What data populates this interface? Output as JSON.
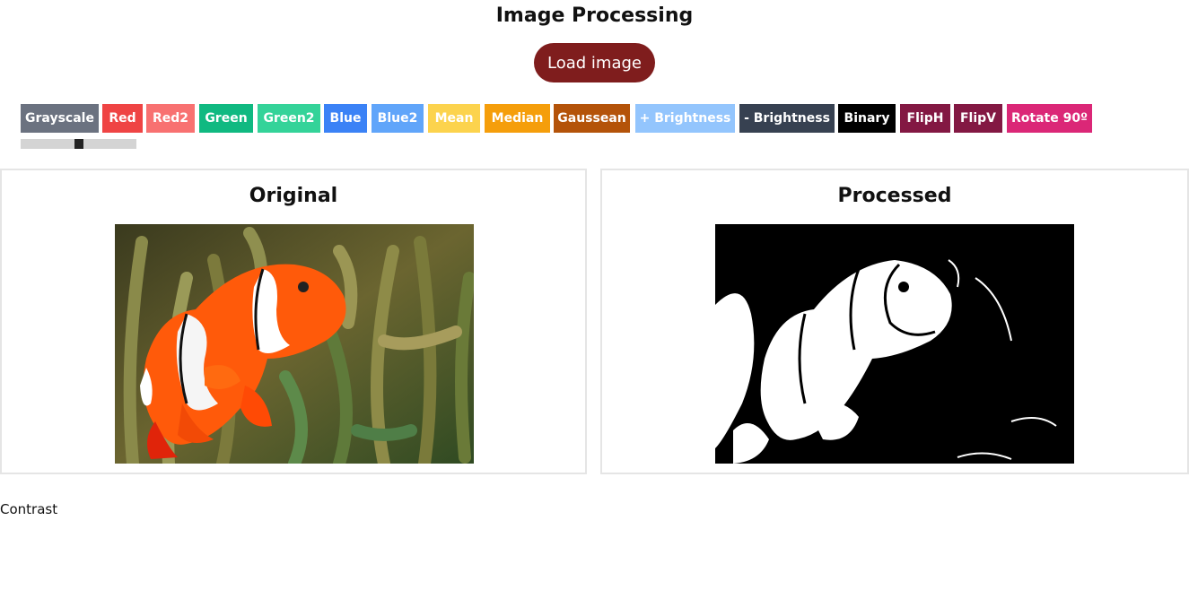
{
  "header": {
    "title": "Image Processing"
  },
  "load_button": {
    "label": "Load image"
  },
  "toolbar": {
    "buttons": [
      {
        "label": "Grayscale",
        "color": "#6b7280"
      },
      {
        "label": "Red",
        "color": "#ef4444"
      },
      {
        "label": "Red2",
        "color": "#f87171"
      },
      {
        "label": "Green",
        "color": "#10b981"
      },
      {
        "label": "Green2",
        "color": "#34d399"
      },
      {
        "label": "Blue",
        "color": "#3b82f6"
      },
      {
        "label": "Blue2",
        "color": "#60a5fa"
      },
      {
        "label": "Mean",
        "color": "#fcd34d"
      },
      {
        "label": "Median",
        "color": "#f59e0b"
      },
      {
        "label": "Gaussean",
        "color": "#b45309"
      },
      {
        "label": "+ Brightness",
        "color": "#93c5fd"
      },
      {
        "label": "- Brightness",
        "color": "#374151"
      },
      {
        "label": "Binary",
        "color": "#000000"
      },
      {
        "label": "FlipH",
        "color": "#831843"
      },
      {
        "label": "FlipV",
        "color": "#831843"
      },
      {
        "label": "Rotate 90º",
        "color": "#db2777"
      }
    ]
  },
  "slider": {
    "value": 0.5
  },
  "panels": {
    "original": {
      "title": "Original"
    },
    "processed": {
      "title": "Processed"
    }
  },
  "contrast": {
    "label": "Contrast"
  }
}
